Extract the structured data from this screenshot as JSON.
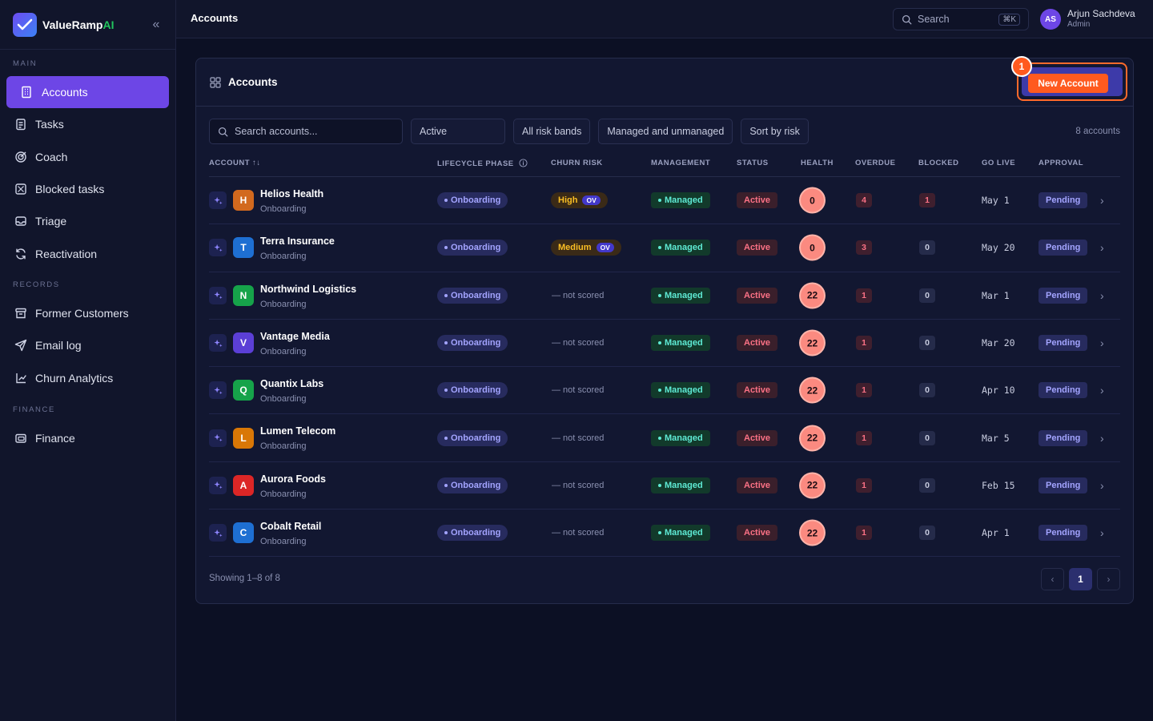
{
  "brand": {
    "name": "ValueRamp",
    "suffix": "AI",
    "collapse_icon": "«"
  },
  "sidebar": {
    "sections": [
      {
        "label": "MAIN",
        "items": [
          {
            "label": "Accounts",
            "icon": "building-icon",
            "active": true
          },
          {
            "label": "Tasks",
            "icon": "clipboard-icon"
          },
          {
            "label": "Coach",
            "icon": "target-icon"
          },
          {
            "label": "Blocked tasks",
            "icon": "blocked-icon"
          },
          {
            "label": "Triage",
            "icon": "inbox-icon"
          },
          {
            "label": "Reactivation",
            "icon": "refresh-icon"
          }
        ]
      },
      {
        "label": "RECORDS",
        "items": [
          {
            "label": "Former Customers",
            "icon": "archive-icon"
          },
          {
            "label": "Email log",
            "icon": "send-icon"
          },
          {
            "label": "Churn Analytics",
            "icon": "chart-icon"
          }
        ]
      },
      {
        "label": "FINANCE",
        "items": [
          {
            "label": "Finance",
            "icon": "wallet-icon"
          }
        ]
      }
    ]
  },
  "topbar": {
    "title": "Accounts",
    "search_label": "Search",
    "search_shortcut": "⌘K",
    "user": {
      "initials": "AS",
      "name": "Arjun Sachdeva",
      "role": "Admin"
    }
  },
  "panel": {
    "title": "Accounts",
    "new_button": "New Account",
    "step_badge": "1",
    "filters": {
      "search_placeholder": "Search accounts...",
      "lifecycle": "Active",
      "risk": "All risk bands",
      "management": "Managed and unmanaged",
      "sort": "Sort by risk"
    },
    "count": "8 accounts",
    "columns": {
      "account": "ACCOUNT ↑↓",
      "lifecycle": "LIFECYCLE PHASE",
      "churn": "CHURN RISK",
      "management": "MANAGEMENT",
      "status": "STATUS",
      "health": "HEALTH",
      "overdue": "OVERDUE",
      "blocked": "BLOCKED",
      "golive": "GO LIVE",
      "approval": "APPROVAL"
    },
    "rows": [
      {
        "initial": "H",
        "color": "#d2691e",
        "name": "Helios Health",
        "sub": "Onboarding",
        "phase": "Onboarding",
        "risk": "High",
        "risk_tag": "OV",
        "mgmt": "Managed",
        "status": "Active",
        "health": "0",
        "overdue": "4",
        "blocked": "1",
        "golive": "May 1",
        "approval": "Pending"
      },
      {
        "initial": "T",
        "color": "#1e6fd2",
        "name": "Terra Insurance",
        "sub": "Onboarding",
        "phase": "Onboarding",
        "risk": "Medium",
        "risk_tag": "OV",
        "mgmt": "Managed",
        "status": "Active",
        "health": "0",
        "overdue": "3",
        "blocked": "0",
        "golive": "May 20",
        "approval": "Pending"
      },
      {
        "initial": "N",
        "color": "#16a34a",
        "name": "Northwind Logistics",
        "sub": "Onboarding",
        "phase": "Onboarding",
        "risk_text": "— not scored",
        "mgmt": "Managed",
        "status": "Active",
        "health": "22",
        "overdue": "1",
        "blocked": "0",
        "golive": "Mar 1",
        "approval": "Pending"
      },
      {
        "initial": "V",
        "color": "#5b3fd6",
        "name": "Vantage Media",
        "sub": "Onboarding",
        "phase": "Onboarding",
        "risk_text": "— not scored",
        "mgmt": "Managed",
        "status": "Active",
        "health": "22",
        "overdue": "1",
        "blocked": "0",
        "golive": "Mar 20",
        "approval": "Pending"
      },
      {
        "initial": "Q",
        "color": "#16a34a",
        "name": "Quantix Labs",
        "sub": "Onboarding",
        "phase": "Onboarding",
        "risk_text": "— not scored",
        "mgmt": "Managed",
        "status": "Active",
        "health": "22",
        "overdue": "1",
        "blocked": "0",
        "golive": "Apr 10",
        "approval": "Pending"
      },
      {
        "initial": "L",
        "color": "#d97706",
        "name": "Lumen Telecom",
        "sub": "Onboarding",
        "phase": "Onboarding",
        "risk_text": "— not scored",
        "mgmt": "Managed",
        "status": "Active",
        "health": "22",
        "overdue": "1",
        "blocked": "0",
        "golive": "Mar 5",
        "approval": "Pending"
      },
      {
        "initial": "A",
        "color": "#dc2626",
        "name": "Aurora Foods",
        "sub": "Onboarding",
        "phase": "Onboarding",
        "risk_text": "— not scored",
        "mgmt": "Managed",
        "status": "Active",
        "health": "22",
        "overdue": "1",
        "blocked": "0",
        "golive": "Feb 15",
        "approval": "Pending"
      },
      {
        "initial": "C",
        "color": "#1e6fd2",
        "name": "Cobalt Retail",
        "sub": "Onboarding",
        "phase": "Onboarding",
        "risk_text": "— not scored",
        "mgmt": "Managed",
        "status": "Active",
        "health": "22",
        "overdue": "1",
        "blocked": "0",
        "golive": "Apr 1",
        "approval": "Pending"
      }
    ],
    "footer": "Showing 1–8 of 8",
    "pager": {
      "prev": "‹",
      "current": "1",
      "next": "›"
    }
  }
}
